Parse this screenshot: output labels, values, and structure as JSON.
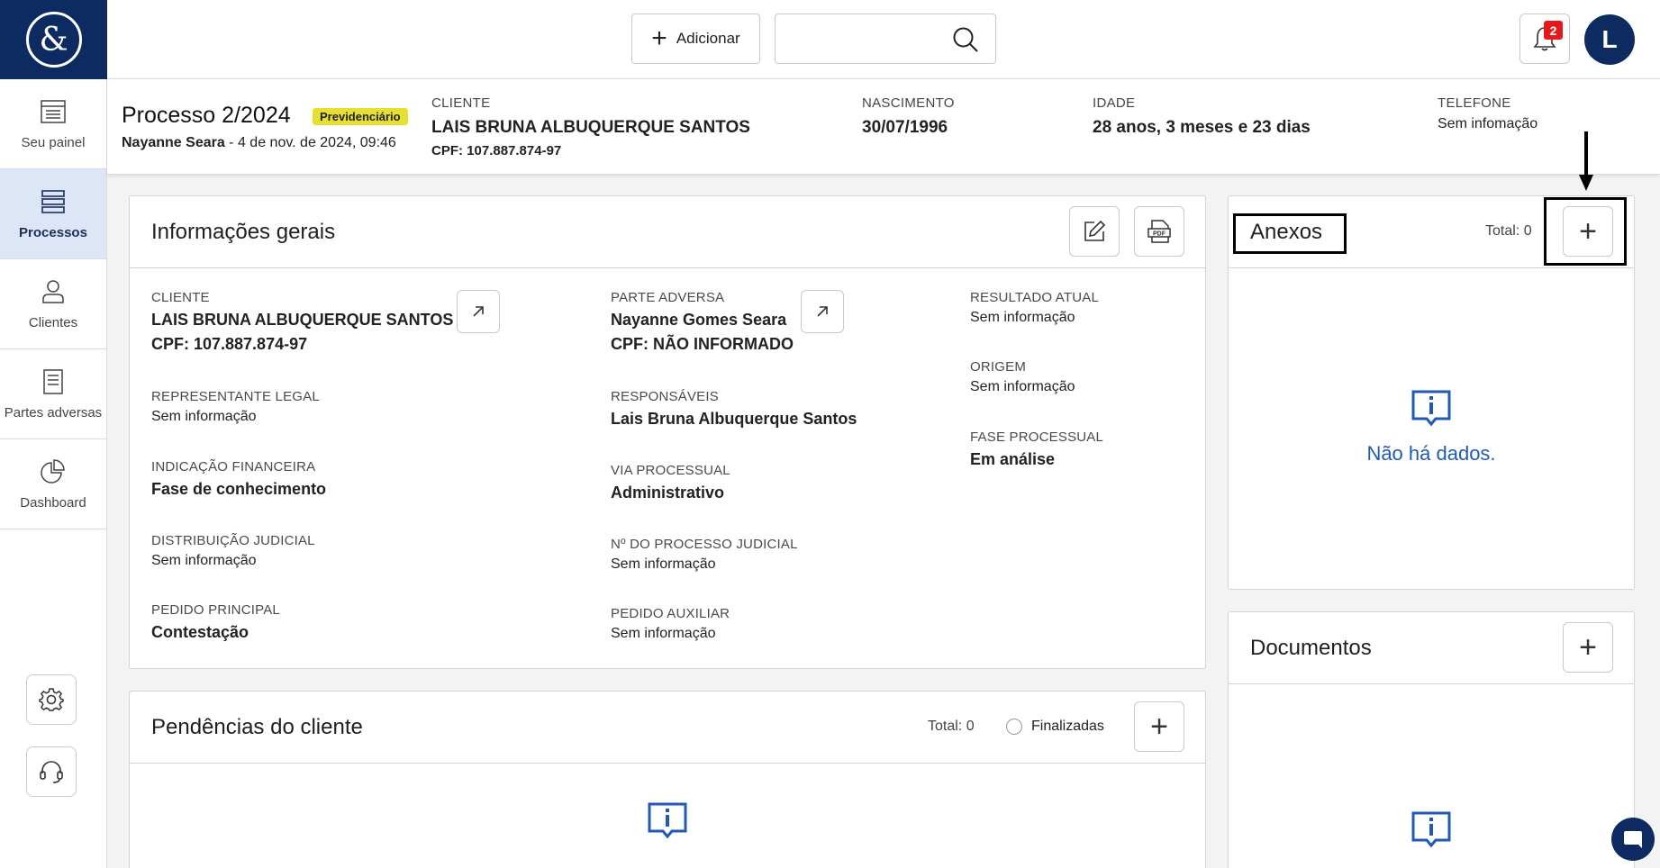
{
  "topbar": {
    "add_label": "Adicionar",
    "search_placeholder": "",
    "notifications_count": "2",
    "avatar_initial": "L"
  },
  "sidebar": {
    "items": [
      {
        "label": "Seu painel",
        "icon": "list-icon"
      },
      {
        "label": "Processos",
        "icon": "stack-icon"
      },
      {
        "label": "Clientes",
        "icon": "user-icon"
      },
      {
        "label": "Partes adversas",
        "icon": "document-icon"
      },
      {
        "label": "Dashboard",
        "icon": "pie-chart-icon"
      }
    ],
    "active_index": 1
  },
  "process": {
    "title": "Processo 2/2024",
    "tag": "Previdenciário",
    "author": "Nayanne Seara",
    "created": " - 4 de nov. de 2024, 09:46",
    "client_label": "CLIENTE",
    "client_name": "LAIS BRUNA ALBUQUERQUE SANTOS",
    "client_cpf": "CPF: 107.887.874-97",
    "birth_label": "NASCIMENTO",
    "birth_value": "30/07/1996",
    "age_label": "IDADE",
    "age_value": "28 anos, 3 meses e 23 dias",
    "phone_label": "TELEFONE",
    "phone_value": "Sem infomação"
  },
  "info": {
    "title": "Informações gerais",
    "fields": {
      "cliente_label": "CLIENTE",
      "cliente_value": "LAIS BRUNA ALBUQUERQUE SANTOS",
      "cliente_cpf": "CPF: 107.887.874-97",
      "representante_label": "REPRESENTANTE LEGAL",
      "representante_value": "Sem informação",
      "indicacao_label": "INDICAÇÃO FINANCEIRA",
      "indicacao_value": "Fase de conhecimento",
      "distribuicao_label": "DISTRIBUIÇÃO JUDICIAL",
      "distribuicao_value": "Sem informação",
      "pedido_principal_label": "PEDIDO PRINCIPAL",
      "pedido_principal_value": "Contestação",
      "parte_label": "PARTE ADVERSA",
      "parte_value": "Nayanne Gomes Seara",
      "parte_cpf": "CPF: NÃO INFORMADO",
      "responsaveis_label": "RESPONSÁVEIS",
      "responsaveis_value": "Lais Bruna Albuquerque Santos",
      "via_label": "VIA PROCESSUAL",
      "via_value": "Administrativo",
      "num_label": "Nº DO PROCESSO JUDICIAL",
      "num_value": "Sem informação",
      "pedido_aux_label": "PEDIDO AUXILIAR",
      "pedido_aux_value": "Sem informação",
      "resultado_label": "RESULTADO ATUAL",
      "resultado_value": "Sem informação",
      "origem_label": "ORIGEM",
      "origem_value": "Sem informação",
      "fase_label": "FASE PROCESSUAL",
      "fase_value": "Em análise"
    }
  },
  "pendencias": {
    "title": "Pendências do cliente",
    "total": "Total: 0",
    "finalizadas": "Finalizadas"
  },
  "anexos": {
    "title": "Anexos",
    "total": "Total: 0",
    "empty": "Não há dados."
  },
  "documentos": {
    "title": "Documentos"
  },
  "colors": {
    "brand": "#0d2b61",
    "accent_blue": "#1f5bb5",
    "tag_yellow": "#e7e033",
    "badge_red": "#e3191b"
  }
}
